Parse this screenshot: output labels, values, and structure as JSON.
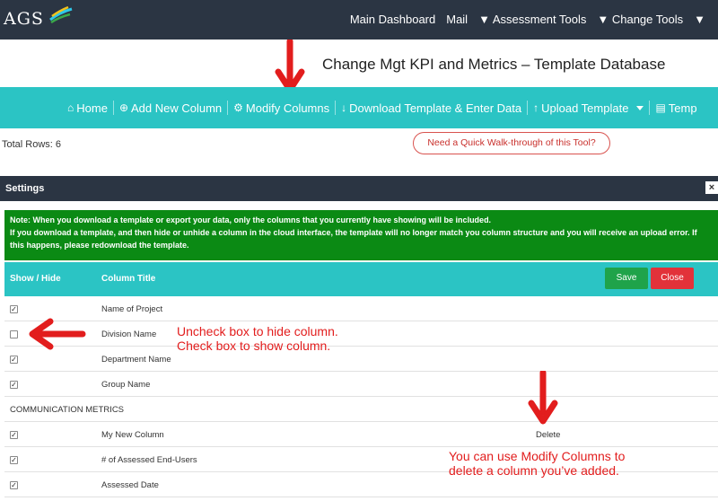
{
  "app": {
    "logo": "AGS"
  },
  "topnav": {
    "items": [
      "Main Dashboard",
      "Mail",
      "▼ Assessment Tools",
      "▼ Change Tools",
      "▼"
    ]
  },
  "page": {
    "title": "Change Mgt KPI and Metrics – Template Database"
  },
  "toolbar": {
    "home": "Home",
    "add_column": "Add New Column",
    "modify_columns": "Modify Columns",
    "download": "Download Template & Enter Data",
    "upload": "Upload Template",
    "template": "Temp"
  },
  "status": {
    "total_rows": "Total Rows: 6"
  },
  "help": {
    "walkthrough": "Need a Quick Walk-through of this Tool?"
  },
  "settings": {
    "title": "Settings",
    "close_symbol": "×",
    "note_line1": "Note: When you download a template or export your data, only the columns that you currently have showing will be included.",
    "note_line2": "If you download a template, and then hide or unhide a column in the cloud interface, the template will no longer match you column structure and you will receive an upload error. If this happens, please redownload the template.",
    "header_show": "Show / Hide",
    "header_title": "Column Title",
    "save_label": "Save",
    "close_label": "Close",
    "rows": [
      {
        "name": "Name of Project",
        "checked": true
      },
      {
        "name": "Division Name",
        "checked": false
      },
      {
        "name": "Department Name",
        "checked": true
      },
      {
        "name": "Group Name",
        "checked": true
      },
      {
        "section": "COMMUNICATION METRICS"
      },
      {
        "name": "My New Column",
        "checked": true,
        "delete": "Delete"
      },
      {
        "name": "# of Assessed End-Users",
        "checked": true
      },
      {
        "name": "Assessed Date",
        "checked": true
      }
    ]
  },
  "annotations": {
    "hide_line1": "Uncheck box to hide column.",
    "hide_line2": "Check box to show column.",
    "modify_line1": "You can use Modify Columns to",
    "modify_line2": "delete a column you’ve added."
  },
  "colors": {
    "topbar": "#2b3543",
    "teal": "#2bc4c4",
    "note_green": "#0b8a14",
    "save_green": "#1fa34a",
    "close_red": "#e2323a",
    "annotation_red": "#e21d1d"
  }
}
